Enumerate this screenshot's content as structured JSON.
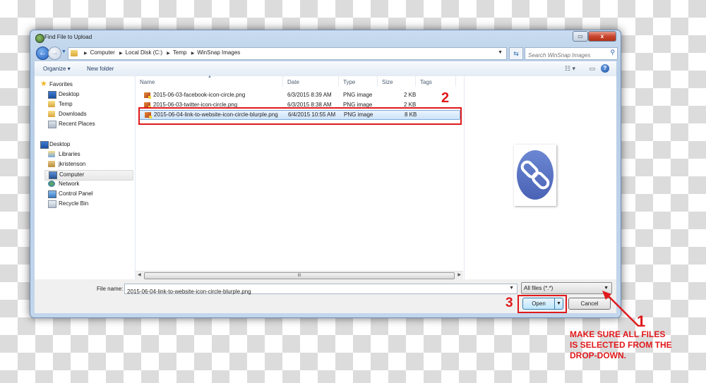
{
  "window": {
    "title": "Find File to Upload",
    "restore_icon": "restore-icon",
    "close_label": "x"
  },
  "navigation": {
    "back_icon": "back-arrow-icon",
    "forward_icon": "forward-arrow-icon",
    "breadcrumbs": [
      "Computer",
      "Local Disk (C:)",
      "Temp",
      "WinSnap Images"
    ],
    "refresh_icon": "refresh-icon",
    "search_placeholder": "Search WinSnap Images"
  },
  "toolbar": {
    "organize_label": "Organize ▾",
    "new_folder_label": "New folder",
    "view_icon": "view-options-icon",
    "preview_pane_icon": "preview-pane-icon",
    "help_label": "?"
  },
  "sidebar": {
    "items": [
      {
        "label": "Favorites",
        "icon": "star-icon",
        "indent": 0
      },
      {
        "label": "Desktop",
        "icon": "desktop-icon",
        "indent": 1
      },
      {
        "label": "Temp",
        "icon": "folder-icon",
        "indent": 1
      },
      {
        "label": "Downloads",
        "icon": "downloads-icon",
        "indent": 1
      },
      {
        "label": "Recent Places",
        "icon": "recent-places-icon",
        "indent": 1
      },
      {
        "label": "Desktop",
        "icon": "desktop-icon",
        "indent": 0
      },
      {
        "label": "Libraries",
        "icon": "libraries-icon",
        "indent": 1
      },
      {
        "label": "jkristenson",
        "icon": "user-folder-icon",
        "indent": 1
      },
      {
        "label": "Computer",
        "icon": "computer-icon",
        "indent": 1,
        "selected": true
      },
      {
        "label": "Network",
        "icon": "network-icon",
        "indent": 1
      },
      {
        "label": "Control Panel",
        "icon": "control-panel-icon",
        "indent": 1
      },
      {
        "label": "Recycle Bin",
        "icon": "recycle-bin-icon",
        "indent": 1
      }
    ]
  },
  "file_list": {
    "columns": [
      "Name",
      "Date",
      "Type",
      "Size",
      "Tags"
    ],
    "rows": [
      {
        "name": "2015-06-03-facebook-icon-circle.png",
        "date": "6/3/2015 8:39 AM",
        "type": "PNG image",
        "size": "2 KB"
      },
      {
        "name": "2015-06-03-twitter-icon-circle.png",
        "date": "6/3/2015 8:38 AM",
        "type": "PNG image",
        "size": "2 KB"
      },
      {
        "name": "2015-06-04-link-to-website-icon-circle-blurple.png",
        "date": "6/4/2015 10:55 AM",
        "type": "PNG image",
        "size": "8 KB",
        "selected": true
      }
    ],
    "scroll_grip": "III"
  },
  "preview": {
    "icon": "link-chain-icon",
    "circle_color": "#5471c0"
  },
  "footer": {
    "file_name_label": "File name:",
    "file_name_value": "2015-06-04-link-to-website-icon-circle-blurple.png",
    "filter_value": "All files (*.*)",
    "open_label": "Open",
    "cancel_label": "Cancel"
  },
  "annotations": {
    "color": "#e0191b",
    "step1": "1",
    "step2": "2",
    "step3": "3",
    "note_lines": [
      "MAKE SURE ALL FILES",
      "IS SELECTED FROM THE",
      "DROP-DOWN."
    ]
  }
}
